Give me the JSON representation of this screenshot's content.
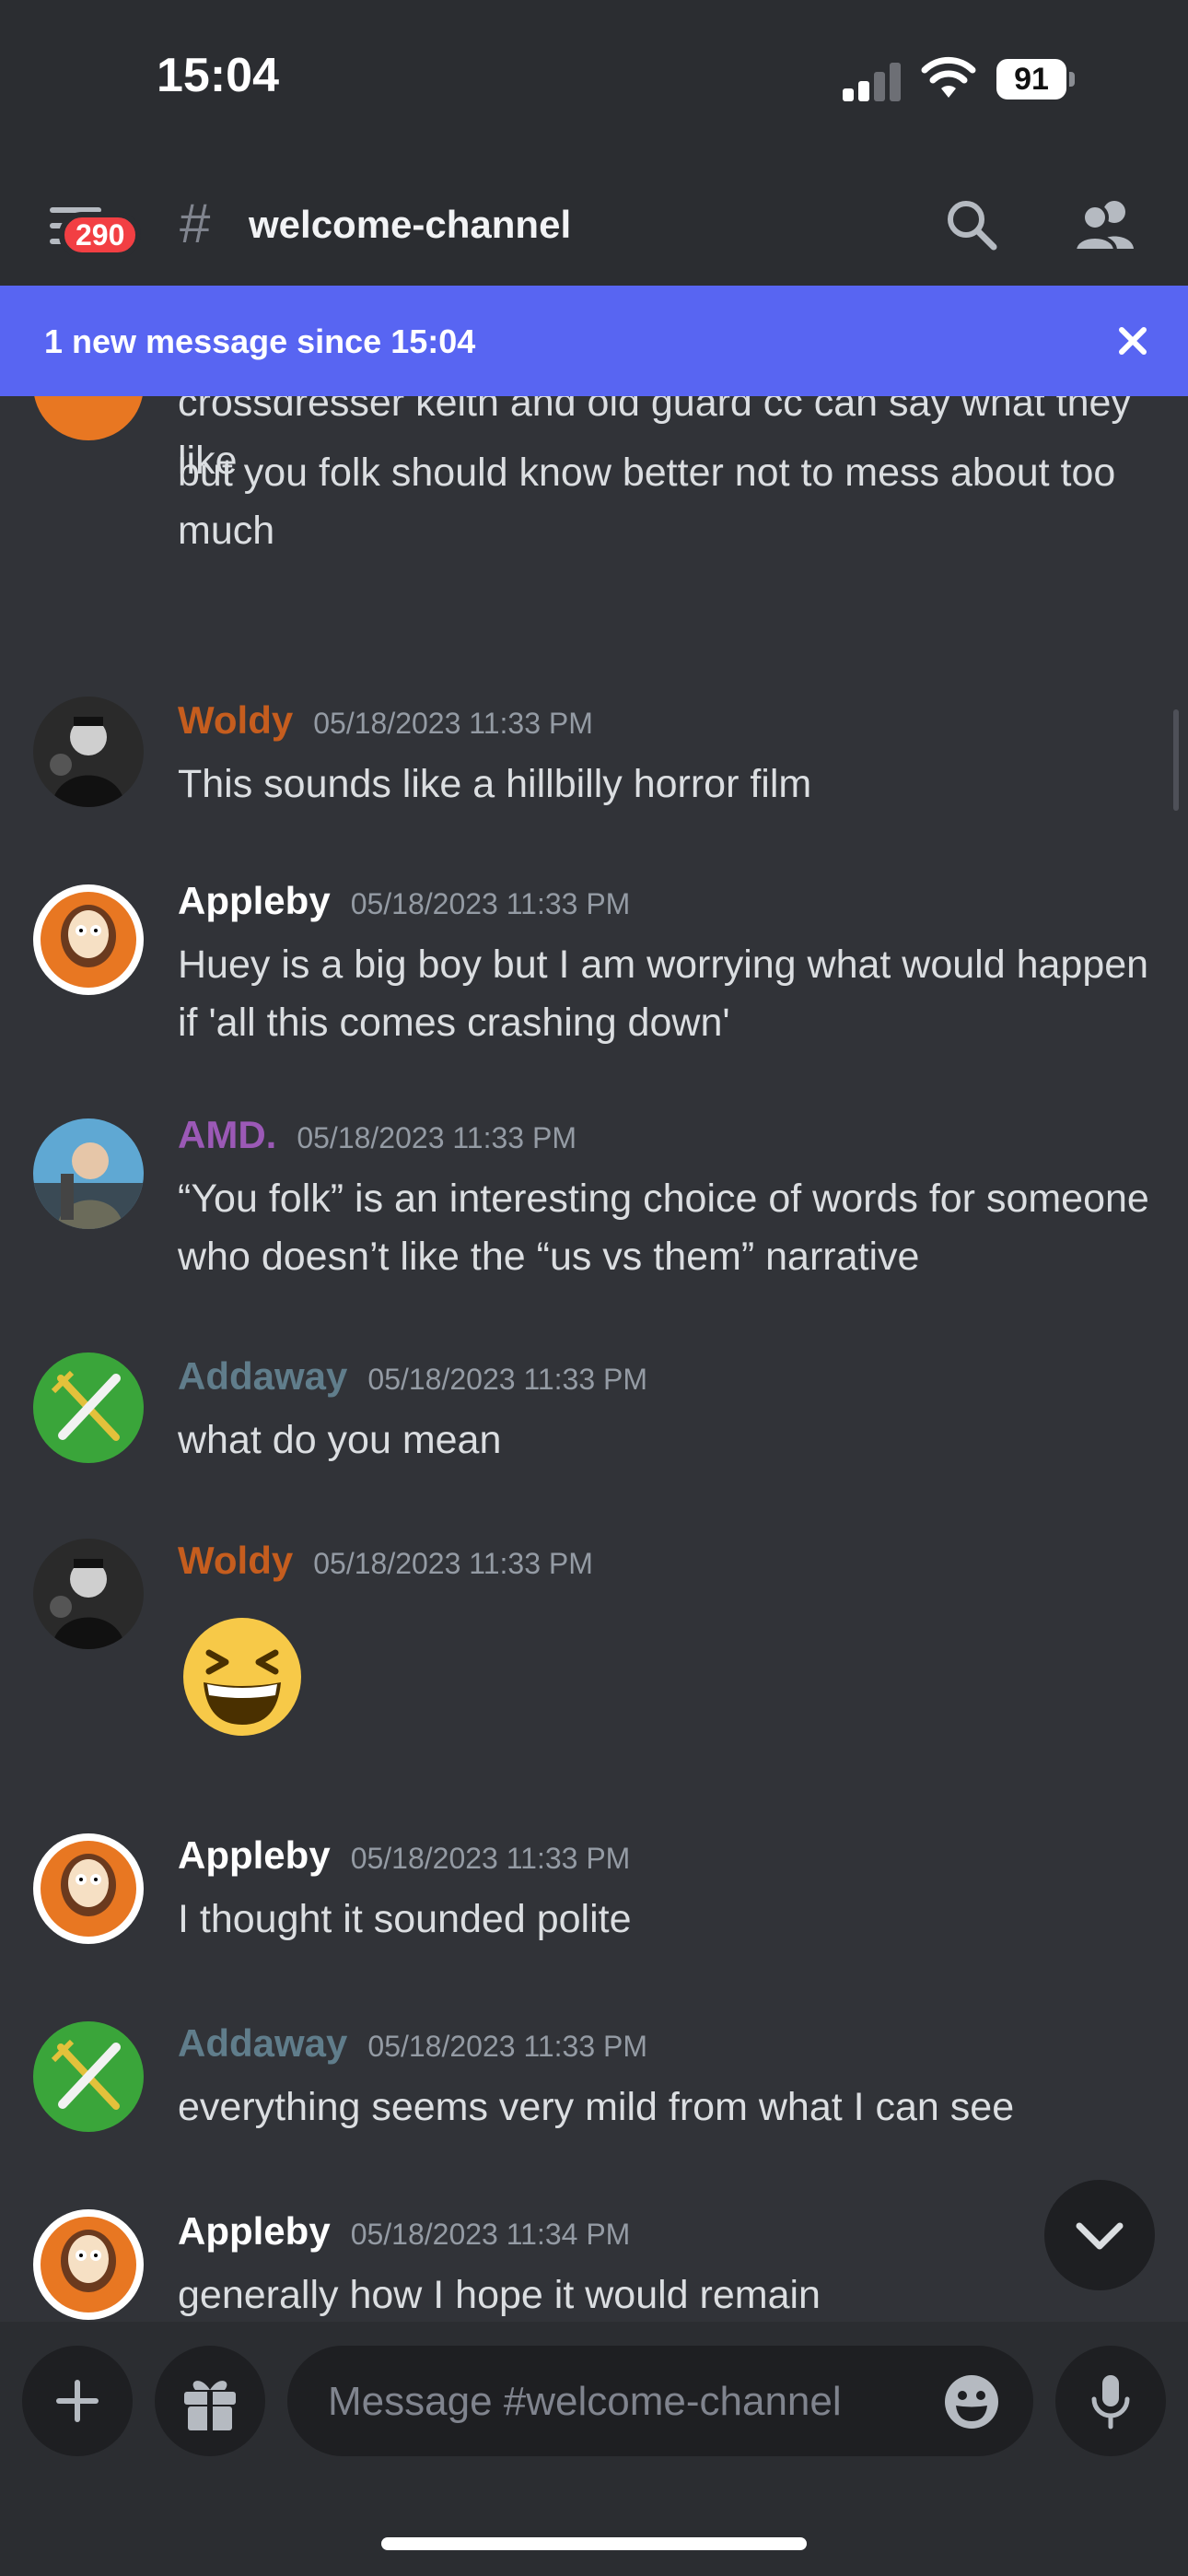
{
  "status_bar": {
    "time": "15:04",
    "battery": "91"
  },
  "header": {
    "unread_badge": "290",
    "channel_name": "welcome-channel"
  },
  "banner": {
    "text": "1 new message since 15:04"
  },
  "messages": [
    {
      "continuation_lines": [
        "crossdresser keith and old guard cc can say what they like",
        "but you folk should know better not to mess about too much"
      ]
    },
    {
      "author": "Woldy",
      "color": "#c55d1e",
      "timestamp": "05/18/2023 11:33 PM",
      "text": "This sounds like a hillbilly horror film"
    },
    {
      "author": "Appleby",
      "color": "#ffffff",
      "timestamp": "05/18/2023 11:33 PM",
      "text": "Huey is a big boy but I am worrying what would happen if 'all this comes crashing down'"
    },
    {
      "author": "AMD.",
      "color": "#9b59b6",
      "timestamp": "05/18/2023 11:33 PM",
      "text": "“You folk” is an interesting choice of words for someone who doesn’t like the “us vs them” narrative"
    },
    {
      "author": "Addaway",
      "color": "#607d8b",
      "timestamp": "05/18/2023 11:33 PM",
      "text": "what do you mean"
    },
    {
      "author": "Woldy",
      "color": "#c55d1e",
      "timestamp": "05/18/2023 11:33 PM",
      "emoji": "grinning-squinting-face"
    },
    {
      "author": "Appleby",
      "color": "#ffffff",
      "timestamp": "05/18/2023 11:33 PM",
      "text": "I thought it sounded polite"
    },
    {
      "author": "Addaway",
      "color": "#607d8b",
      "timestamp": "05/18/2023 11:33 PM",
      "text": "everything seems very mild from what I can see"
    },
    {
      "author": "Appleby",
      "color": "#ffffff",
      "timestamp": "05/18/2023 11:34 PM",
      "text": "generally how I hope it would remain"
    }
  ],
  "composer": {
    "placeholder": "Message #welcome-channel"
  }
}
